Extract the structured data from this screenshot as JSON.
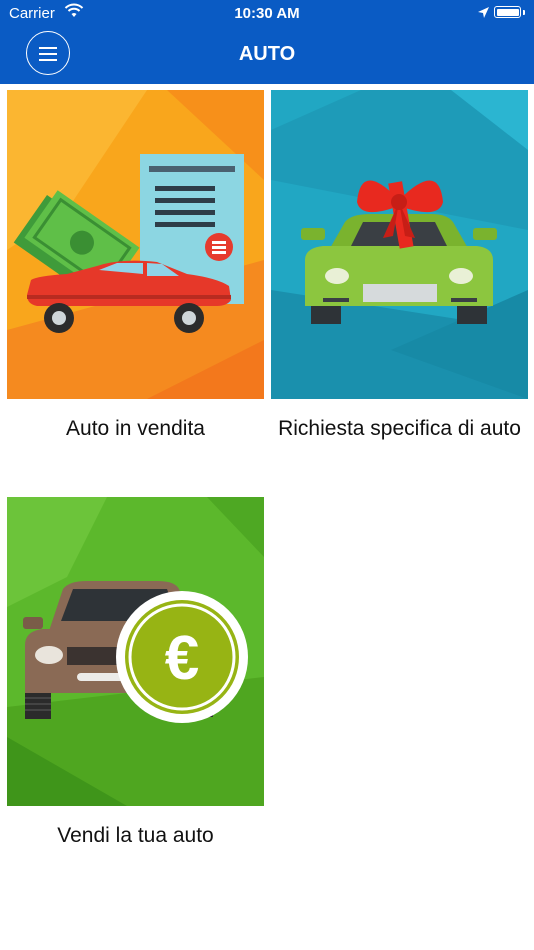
{
  "status_bar": {
    "carrier": "Carrier",
    "time": "10:30 AM"
  },
  "header": {
    "title": "AUTO",
    "menu_icon": "hamburger-icon"
  },
  "tiles": [
    {
      "label": "Auto in vendita",
      "icon": "car-for-sale-illustration"
    },
    {
      "label": "Richiesta specifica di auto",
      "icon": "gift-car-illustration"
    },
    {
      "label": "Vendi la tua auto",
      "icon": "sell-car-euro-illustration",
      "euro_symbol": "€"
    }
  ],
  "colors": {
    "header": "#0a5bc4",
    "tile1_bg": "#f7a21a",
    "tile2_bg": "#21a7c3",
    "tile3_bg": "#5cb82c"
  }
}
